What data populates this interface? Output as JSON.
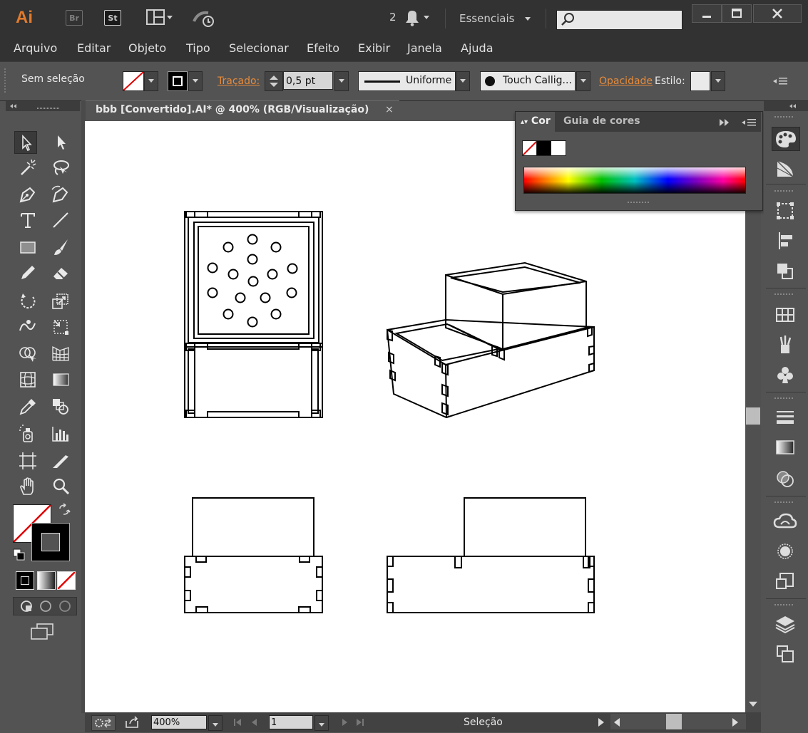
{
  "app": {
    "logo": "Ai",
    "bridge_label": "Br",
    "stock_label": "St",
    "notification_count": "2",
    "workspace": "Essenciais",
    "search_placeholder": ""
  },
  "menu": [
    "Arquivo",
    "Editar",
    "Objeto",
    "Tipo",
    "Selecionar",
    "Efeito",
    "Exibir",
    "Janela",
    "Ajuda"
  ],
  "control": {
    "selection_status": "Sem seleção",
    "stroke_label": "Traçado:",
    "stroke_weight": "0,5 pt",
    "profile": "Uniforme",
    "brush": "Touch Callig...",
    "opacity_label": "Opacidade",
    "style_label": "Estilo:"
  },
  "document": {
    "tab_title": "bbb [Convertido].AI* @ 400% (RGB/Visualização)",
    "close": "×"
  },
  "color_panel": {
    "tab_color": "Cor",
    "tab_guide": "Guia de cores"
  },
  "status": {
    "zoom": "400%",
    "page": "1",
    "tool_name": "Seleção"
  },
  "colors": {
    "accent": "#e88b3a",
    "panel": "#535353",
    "chrome": "#323232",
    "canvas": "#ffffff"
  },
  "tools": [
    "selection-tool",
    "direct-selection-tool",
    "magic-wand-tool",
    "lasso-tool",
    "pen-tool",
    "curvature-tool",
    "type-tool",
    "line-segment-tool",
    "rectangle-tool",
    "paintbrush-tool",
    "pencil-tool",
    "eraser-tool",
    "rotate-tool",
    "scale-tool",
    "warp-tool",
    "free-transform-tool",
    "shape-builder-tool",
    "perspective-grid-tool",
    "mesh-tool",
    "gradient-tool",
    "eyedropper-tool",
    "blend-tool",
    "symbol-sprayer-tool",
    "column-graph-tool",
    "artboard-tool",
    "slice-tool",
    "hand-tool",
    "zoom-tool"
  ]
}
